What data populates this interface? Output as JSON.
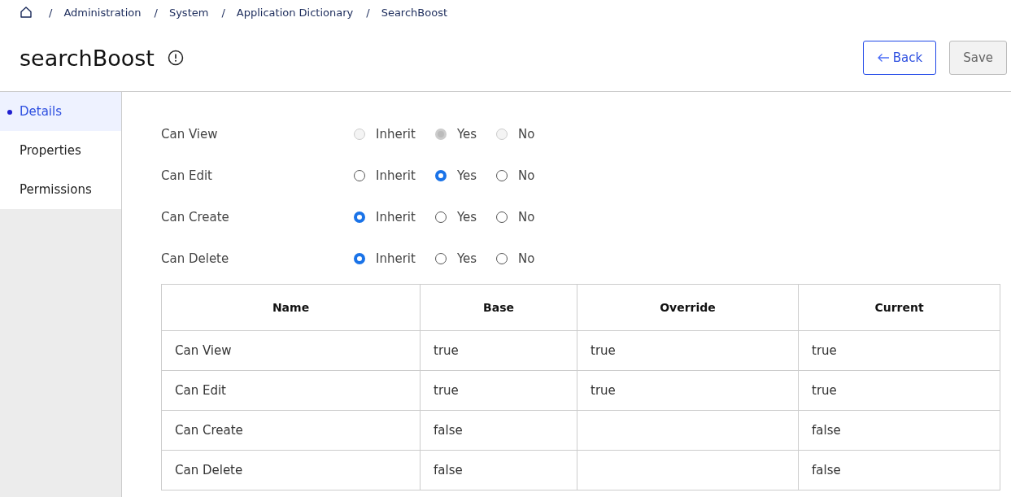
{
  "breadcrumb": [
    {
      "separator": "/",
      "label": "Administration"
    },
    {
      "separator": "/",
      "label": "System"
    },
    {
      "separator": "/",
      "label": "Application Dictionary"
    },
    {
      "separator": "/",
      "label": "SearchBoost"
    }
  ],
  "title": "searchBoost",
  "buttons": [
    {
      "label": "Back",
      "kind": "back",
      "disabled": false
    },
    {
      "label": "Save",
      "kind": "save",
      "disabled": true
    }
  ],
  "sidebar": {
    "items": [
      {
        "label": "Details",
        "selected": true
      },
      {
        "label": "Properties",
        "selected": false
      },
      {
        "label": "Permissions",
        "selected": false
      }
    ]
  },
  "permissions": [
    {
      "label": "Can View",
      "disabled": true,
      "options": [
        {
          "label": "Inherit",
          "selected": false
        },
        {
          "label": "Yes",
          "selected": true
        },
        {
          "label": "No",
          "selected": false
        }
      ]
    },
    {
      "label": "Can Edit",
      "disabled": false,
      "options": [
        {
          "label": "Inherit",
          "selected": false
        },
        {
          "label": "Yes",
          "selected": true
        },
        {
          "label": "No",
          "selected": false
        }
      ]
    },
    {
      "label": "Can Create",
      "disabled": false,
      "options": [
        {
          "label": "Inherit",
          "selected": true
        },
        {
          "label": "Yes",
          "selected": false
        },
        {
          "label": "No",
          "selected": false
        }
      ]
    },
    {
      "label": "Can Delete",
      "disabled": false,
      "options": [
        {
          "label": "Inherit",
          "selected": true
        },
        {
          "label": "Yes",
          "selected": false
        },
        {
          "label": "No",
          "selected": false
        }
      ]
    }
  ],
  "table": {
    "columns": [
      "Name",
      "Base",
      "Override",
      "Current"
    ],
    "rows": [
      [
        "Can View",
        "true",
        "true",
        "true"
      ],
      [
        "Can Edit",
        "true",
        "true",
        "true"
      ],
      [
        "Can Create",
        "false",
        "",
        "false"
      ],
      [
        "Can Delete",
        "false",
        "",
        "false"
      ]
    ]
  }
}
